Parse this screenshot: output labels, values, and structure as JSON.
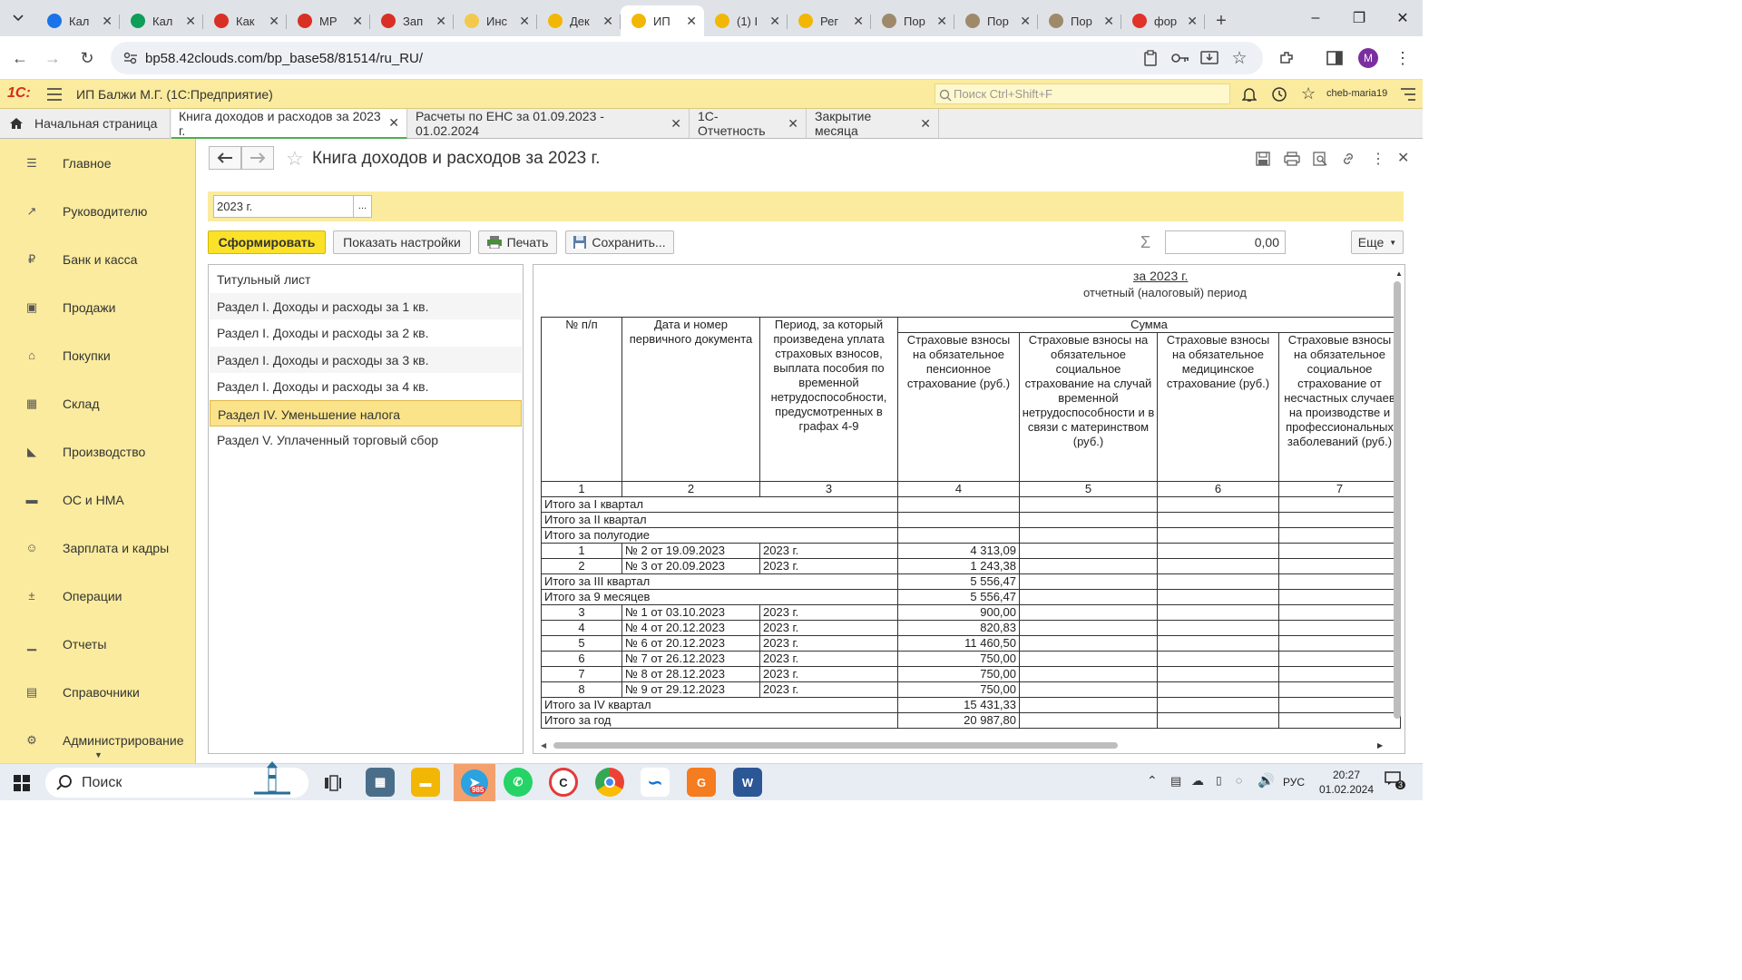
{
  "browser": {
    "tabs": [
      {
        "title": "Кал",
        "icon": "calendar-favicon",
        "color": "#1a73e8"
      },
      {
        "title": "Кал",
        "icon": "sheets-favicon",
        "color": "#0f9d58"
      },
      {
        "title": "Как",
        "icon": "kontur-favicon",
        "color": "#d93025"
      },
      {
        "title": "МР",
        "icon": "target-favicon",
        "color": "#d93025"
      },
      {
        "title": "Зап",
        "icon": "kontur-favicon",
        "color": "#d93025"
      },
      {
        "title": "Инс",
        "icon": "cloud-favicon",
        "color": "#f2c94c"
      },
      {
        "title": "Дек",
        "icon": "buh-favicon",
        "color": "#f2b705"
      },
      {
        "title": "ИП",
        "icon": "1c-favicon",
        "color": "#f2b705"
      },
      {
        "title": "(1) I",
        "icon": "1c-favicon",
        "color": "#f2b705"
      },
      {
        "title": "Рег",
        "icon": "buh-favicon",
        "color": "#f2b705"
      },
      {
        "title": "Пор",
        "icon": "emblem-favicon",
        "color": "#9e8a6b"
      },
      {
        "title": "Пор",
        "icon": "emblem-favicon",
        "color": "#9e8a6b"
      },
      {
        "title": "Пор",
        "icon": "emblem-favicon",
        "color": "#9e8a6b"
      },
      {
        "title": "фор",
        "icon": "yandex-favicon",
        "color": "#e0332a"
      }
    ],
    "active_tab_index": 7,
    "url": "bp58.42clouds.com/bp_base58/81514/ru_RU/",
    "profile_initial": "M"
  },
  "app": {
    "brand": "1С:",
    "title": "ИП Балжи М.Г.  (1С:Предприятие)",
    "search_placeholder": "Поиск Ctrl+Shift+F",
    "user": "cheb-maria19"
  },
  "open_tabs": {
    "home": "Начальная страница",
    "items": [
      {
        "label": "Книга доходов и расходов за 2023 г."
      },
      {
        "label": "Расчеты по ЕНС за 01.09.2023 - 01.02.2024"
      },
      {
        "label": "1С-Отчетность"
      },
      {
        "label": "Закрытие месяца"
      }
    ]
  },
  "sidebar": {
    "items": [
      {
        "label": "Главное",
        "icon": "menu-icon"
      },
      {
        "label": "Руководителю",
        "icon": "trend-icon"
      },
      {
        "label": "Банк и касса",
        "icon": "coin-icon"
      },
      {
        "label": "Продажи",
        "icon": "bag-icon"
      },
      {
        "label": "Покупки",
        "icon": "cart-icon"
      },
      {
        "label": "Склад",
        "icon": "grid-icon"
      },
      {
        "label": "Производство",
        "icon": "factory-icon"
      },
      {
        "label": "ОС и НМА",
        "icon": "truck-icon"
      },
      {
        "label": "Зарплата и кадры",
        "icon": "person-icon"
      },
      {
        "label": "Операции",
        "icon": "dtkt-icon"
      },
      {
        "label": "Отчеты",
        "icon": "barchart-icon"
      },
      {
        "label": "Справочники",
        "icon": "book-icon"
      },
      {
        "label": "Администрирование",
        "icon": "gear-icon"
      }
    ]
  },
  "form": {
    "title": "Книга доходов и расходов за 2023 г.",
    "period": "2023 г.",
    "period_dots": "...",
    "buttons": {
      "generate": "Сформировать",
      "settings": "Показать настройки",
      "print": "Печать",
      "save": "Сохранить...",
      "more": "Еще"
    },
    "sum_value": "0,00",
    "sections": [
      "Титульный лист",
      "Раздел I. Доходы и расходы за 1 кв.",
      "Раздел I. Доходы и расходы за 2 кв.",
      "Раздел I. Доходы и расходы за 3 кв.",
      "Раздел I. Доходы и расходы за 4 кв.",
      "Раздел IV. Уменьшение налога",
      "Раздел V. Уплаченный торговый сбор"
    ],
    "selected_section_index": 5
  },
  "report": {
    "period_title": "за 2023 г.",
    "period_caption": "отчетный (налоговый) период",
    "header": {
      "c1": "№ п/п",
      "c2": "Дата и номер первичного документа",
      "c3": "Период, за который произведена уплата страховых взносов, выплата пособия по временной нетрудоспособности, предусмотренных в графах 4-9",
      "sum_group": "Сумма",
      "c4": "Страховые взносы на обязательное пенсионное страхование (руб.)",
      "c5": "Страховые взносы на обязательное социальное страхование на случай временной нетрудоспособности и в связи с материнством (руб.)",
      "c6": "Страховые взносы на обязательное медицинское страхование (руб.)",
      "c7": "Страховые взносы на обязательное социальное страхование от несчастных случаев на производстве и профессиональных заболеваний (руб.)"
    },
    "col_numbers": [
      "1",
      "2",
      "3",
      "4",
      "5",
      "6",
      "7"
    ],
    "rows": [
      {
        "type": "total",
        "label": "Итого за I квартал",
        "c4": ""
      },
      {
        "type": "total",
        "label": "Итого за II квартал",
        "c4": ""
      },
      {
        "type": "total",
        "label": "Итого за полугодие",
        "c4": ""
      },
      {
        "type": "row",
        "n": "1",
        "doc": "№ 2 от 19.09.2023",
        "period": "2023 г.",
        "c4": "4 313,09"
      },
      {
        "type": "row",
        "n": "2",
        "doc": "№ 3 от 20.09.2023",
        "period": "2023 г.",
        "c4": "1 243,38"
      },
      {
        "type": "total",
        "label": "Итого за III квартал",
        "c4": "5 556,47"
      },
      {
        "type": "total",
        "label": "Итого за 9 месяцев",
        "c4": "5 556,47"
      },
      {
        "type": "row",
        "n": "3",
        "doc": "№ 1 от 03.10.2023",
        "period": "2023 г.",
        "c4": "900,00"
      },
      {
        "type": "row",
        "n": "4",
        "doc": "№ 4 от 20.12.2023",
        "period": "2023 г.",
        "c4": "820,83"
      },
      {
        "type": "row",
        "n": "5",
        "doc": "№ 6 от 20.12.2023",
        "period": "2023 г.",
        "c4": "11 460,50"
      },
      {
        "type": "row",
        "n": "6",
        "doc": "№ 7 от 26.12.2023",
        "period": "2023 г.",
        "c4": "750,00"
      },
      {
        "type": "row",
        "n": "7",
        "doc": "№ 8 от 28.12.2023",
        "period": "2023 г.",
        "c4": "750,00"
      },
      {
        "type": "row",
        "n": "8",
        "doc": "№ 9 от 29.12.2023",
        "period": "2023 г.",
        "c4": "750,00"
      },
      {
        "type": "total",
        "label": "Итого за IV квартал",
        "c4": "15 431,33"
      },
      {
        "type": "total",
        "label": "Итого за год",
        "c4": "20 987,80"
      }
    ]
  },
  "taskbar": {
    "search": "Поиск",
    "telegram_badge": "985",
    "tray_lang": "РУС",
    "time": "20:27",
    "date": "01.02.2024",
    "notif_count": "3"
  }
}
